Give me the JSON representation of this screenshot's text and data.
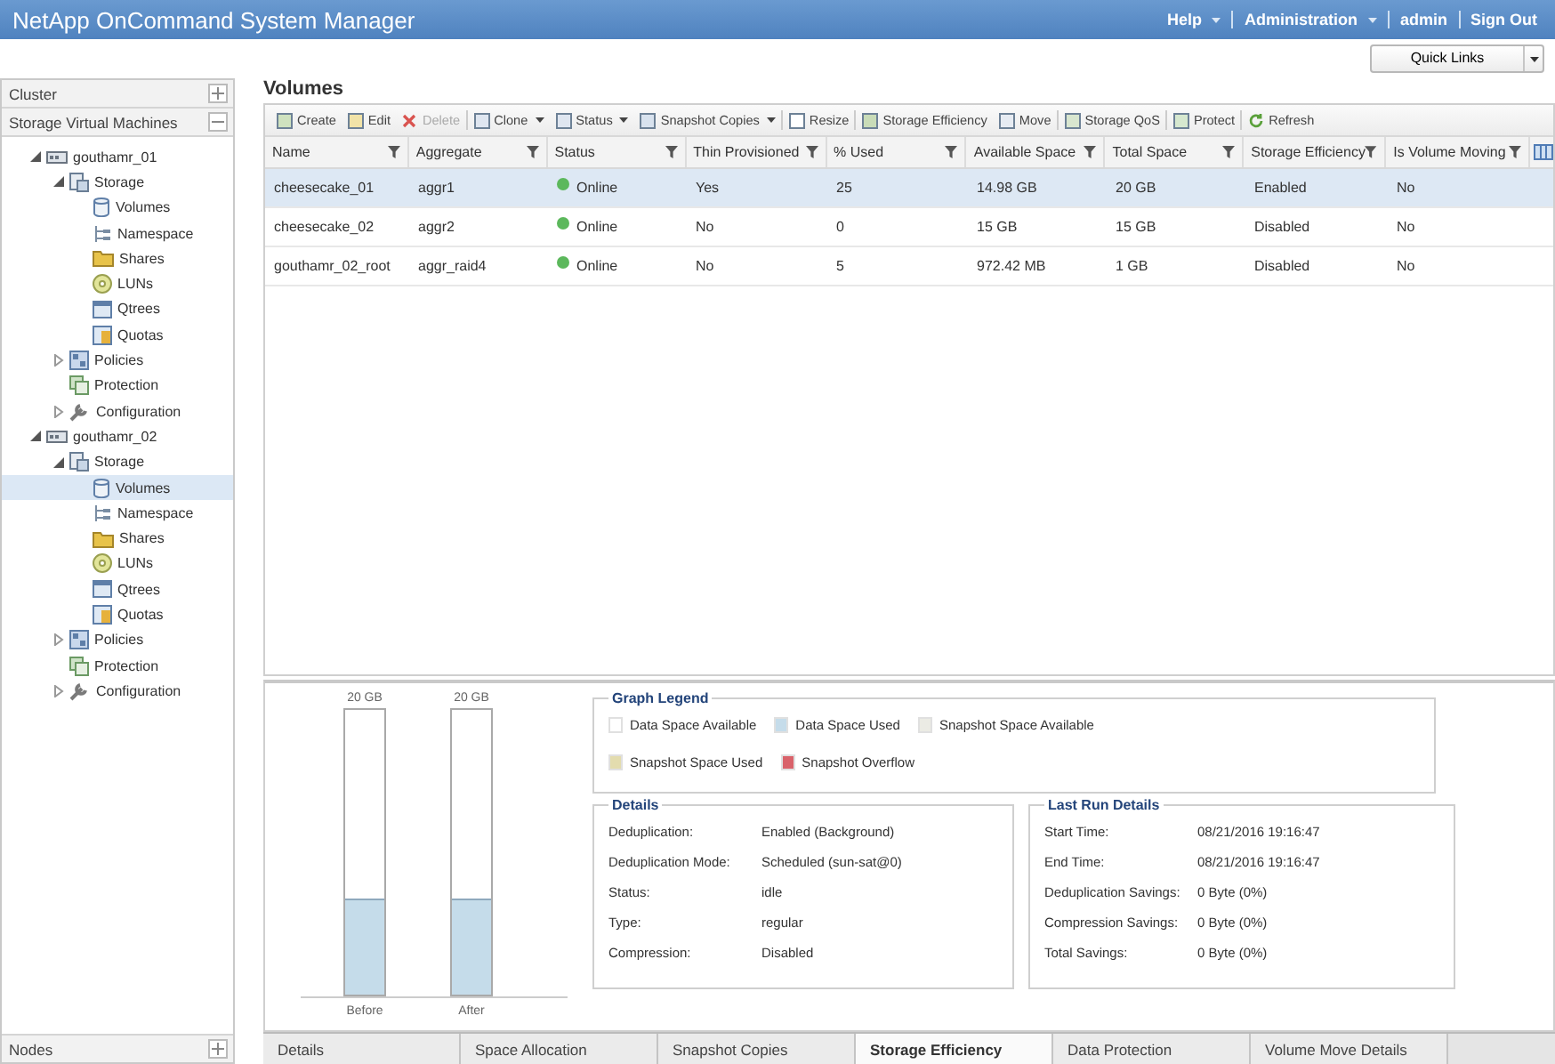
{
  "window": {
    "title": "NetApp OnCommand System Manager"
  },
  "header_links": [
    {
      "label": "Help",
      "dropdown": true
    },
    {
      "label": "Administration",
      "dropdown": true
    },
    {
      "label": "admin",
      "dropdown": false
    },
    {
      "label": "Sign Out",
      "dropdown": false
    }
  ],
  "quick_links": {
    "label": "Quick Links"
  },
  "sidebar": {
    "sections": [
      {
        "label": "Cluster",
        "expanded": false
      },
      {
        "label": "Storage Virtual Machines",
        "expanded": true
      }
    ],
    "tree": [
      {
        "label": "gouthamr_01",
        "expanded": true,
        "selected": false,
        "children": [
          {
            "label": "Storage",
            "expanded": true,
            "selected": false,
            "children": [
              {
                "label": "Volumes",
                "selected": false
              },
              {
                "label": "Namespace",
                "selected": false
              },
              {
                "label": "Shares",
                "selected": false
              },
              {
                "label": "LUNs",
                "selected": false
              },
              {
                "label": "Qtrees",
                "selected": false
              },
              {
                "label": "Quotas",
                "selected": false
              }
            ]
          },
          {
            "label": "Policies",
            "expanded": false,
            "selected": false
          },
          {
            "label": "Protection",
            "selected": false
          },
          {
            "label": "Configuration",
            "expanded": false,
            "selected": false
          }
        ]
      },
      {
        "label": "gouthamr_02",
        "expanded": true,
        "selected": false,
        "children": [
          {
            "label": "Storage",
            "expanded": true,
            "selected": false,
            "children": [
              {
                "label": "Volumes",
                "selected": true
              },
              {
                "label": "Namespace",
                "selected": false
              },
              {
                "label": "Shares",
                "selected": false
              },
              {
                "label": "LUNs",
                "selected": false
              },
              {
                "label": "Qtrees",
                "selected": false
              },
              {
                "label": "Quotas",
                "selected": false
              }
            ]
          },
          {
            "label": "Policies",
            "expanded": false,
            "selected": false
          },
          {
            "label": "Protection",
            "selected": false
          },
          {
            "label": "Configuration",
            "expanded": false,
            "selected": false
          }
        ]
      }
    ],
    "footer": {
      "label": "Nodes",
      "expanded": false
    }
  },
  "page_title": "Volumes",
  "toolbar": [
    {
      "label": "Create",
      "disabled": false,
      "dropdown": false
    },
    {
      "label": "Edit",
      "disabled": false,
      "dropdown": false
    },
    {
      "label": "Delete",
      "disabled": true,
      "dropdown": false
    },
    {
      "label": "Clone",
      "disabled": false,
      "dropdown": true
    },
    {
      "label": "Status",
      "disabled": false,
      "dropdown": true
    },
    {
      "label": "Snapshot Copies",
      "disabled": false,
      "dropdown": true
    },
    {
      "label": "Resize",
      "disabled": false,
      "dropdown": false
    },
    {
      "label": "Storage Efficiency",
      "disabled": false,
      "dropdown": false
    },
    {
      "label": "Move",
      "disabled": false,
      "dropdown": false
    },
    {
      "label": "Storage QoS",
      "disabled": false,
      "dropdown": false
    },
    {
      "label": "Protect",
      "disabled": false,
      "dropdown": false
    },
    {
      "label": "Refresh",
      "disabled": false,
      "dropdown": false
    }
  ],
  "table": {
    "columns": [
      "Name",
      "Aggregate",
      "Status",
      "Thin Provisioned",
      "% Used",
      "Available Space",
      "Total Space",
      "Storage Efficiency",
      "Is Volume Moving"
    ],
    "rows": [
      {
        "selected": true,
        "cells": [
          "cheesecake_01",
          "aggr1",
          "Online",
          "Yes",
          "25",
          "14.98 GB",
          "20 GB",
          "Enabled",
          "No"
        ]
      },
      {
        "selected": false,
        "cells": [
          "cheesecake_02",
          "aggr2",
          "Online",
          "No",
          "0",
          "15 GB",
          "15 GB",
          "Disabled",
          "No"
        ]
      },
      {
        "selected": false,
        "cells": [
          "gouthamr_02_root",
          "aggr_raid4",
          "Online",
          "No",
          "5",
          "972.42 MB",
          "1 GB",
          "Disabled",
          "No"
        ]
      }
    ]
  },
  "space_bars": [
    {
      "top_label": "20 GB",
      "label": "Before",
      "level": 0.33
    },
    {
      "top_label": "20 GB",
      "label": "After",
      "level": 0.33
    }
  ],
  "graph_legend": {
    "title": "Graph Legend",
    "items": [
      {
        "label": "Data Space Available",
        "color": "#ffffff"
      },
      {
        "label": "Data Space Used",
        "color": "#c5dcea"
      },
      {
        "label": "Snapshot Space Available",
        "color": "#ebebe4"
      },
      {
        "label": "Snapshot Space Used",
        "color": "#e3dcae"
      },
      {
        "label": "Snapshot Overflow",
        "color": "#d9626a"
      }
    ]
  },
  "details": {
    "title": "Details",
    "fields": [
      {
        "label": "Deduplication:",
        "value": "Enabled (Background)"
      },
      {
        "label": "Deduplication Mode:",
        "value": "Scheduled (sun-sat@0)"
      },
      {
        "label": "Status:",
        "value": "idle"
      },
      {
        "label": "Type:",
        "value": "regular"
      },
      {
        "label": "Compression:",
        "value": "Disabled"
      }
    ]
  },
  "last_run_details": {
    "title": "Last Run Details",
    "fields": [
      {
        "label": "Start Time:",
        "value": "08/21/2016 19:16:47"
      },
      {
        "label": "End Time:",
        "value": "08/21/2016 19:16:47"
      },
      {
        "label": "Deduplication Savings:",
        "value": "0 Byte (0%)"
      },
      {
        "label": "Compression Savings:",
        "value": "0 Byte (0%)"
      },
      {
        "label": "Total Savings:",
        "value": "0 Byte (0%)"
      }
    ]
  },
  "bottom_tabs": [
    {
      "label": "Details",
      "selected": false
    },
    {
      "label": "Space Allocation",
      "selected": false
    },
    {
      "label": "Snapshot Copies",
      "selected": false
    },
    {
      "label": "Storage Efficiency",
      "selected": true
    },
    {
      "label": "Data Protection",
      "selected": false
    },
    {
      "label": "Volume Move Details",
      "selected": false
    }
  ]
}
